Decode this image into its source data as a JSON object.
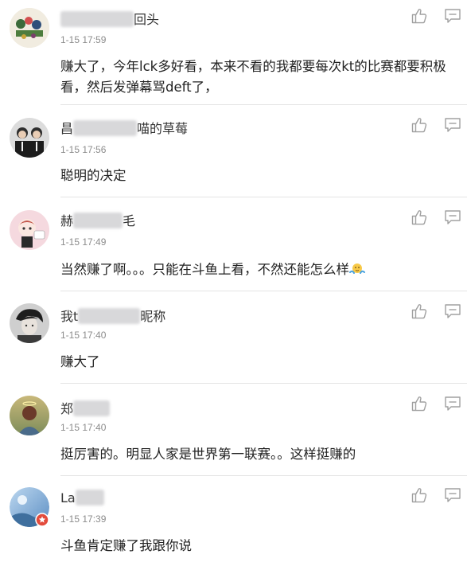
{
  "comments": [
    {
      "name_suffix": "回头",
      "time": "1-15 17:59",
      "text": "赚大了，今年lck多好看，本来不看的我都要每次kt的比赛都要积极看，然后发弹幕骂deft了，"
    },
    {
      "name_prefix": "昌",
      "name_suffix": "喵的草莓",
      "time": "1-15 17:56",
      "text": "聪明的决定"
    },
    {
      "name_prefix": "赫",
      "name_suffix": "毛",
      "time": "1-15 17:49",
      "text": "当然赚了啊。。。只能在斗鱼上看，不然还能怎么样"
    },
    {
      "name_prefix": "我t",
      "name_suffix": "昵称",
      "time": "1-15 17:40",
      "text": "赚大了"
    },
    {
      "name_prefix": "郑",
      "time": "1-15 17:40",
      "text": "挺厉害的。明显人家是世界第一联赛。。这样挺赚的"
    },
    {
      "name_prefix": "La",
      "time": "1-15 17:39",
      "text": "斗鱼肯定赚了我跟你说"
    }
  ],
  "icons": {
    "like": "thumbs-up-icon",
    "reply": "comment-bubble-icon"
  },
  "colors": {
    "icon_gray": "#a0a0a0",
    "time_gray": "#8c8c8c",
    "divider": "#e4e4e4"
  }
}
